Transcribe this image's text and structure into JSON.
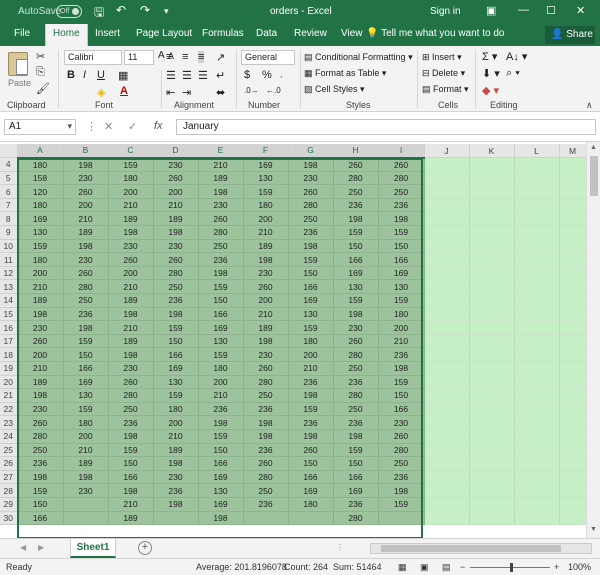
{
  "titlebar": {
    "autosave_label": "AutoSave",
    "autosave_state": "Off",
    "title": "orders - Excel",
    "signin": "Sign in"
  },
  "tabs": [
    "File",
    "Home",
    "Insert",
    "Page Layout",
    "Formulas",
    "Data",
    "Review",
    "View"
  ],
  "active_tab": "Home",
  "tell_me": "Tell me what you want to do",
  "share": "Share",
  "ribbon": {
    "groups": [
      "Clipboard",
      "Font",
      "Alignment",
      "Number",
      "Styles",
      "Cells",
      "Editing"
    ],
    "paste_label": "Paste",
    "font_name": "Calibri",
    "font_size": "11",
    "number_format": "General",
    "styles": [
      "Conditional Formatting",
      "Format as Table",
      "Cell Styles"
    ],
    "cells": [
      "Insert",
      "Delete",
      "Format"
    ]
  },
  "formula_bar": {
    "name_box": "A1",
    "value": "January"
  },
  "grid": {
    "columns": [
      "A",
      "B",
      "C",
      "D",
      "E",
      "F",
      "G",
      "H",
      "I",
      "J",
      "K",
      "L",
      "M"
    ],
    "selected_columns": [
      "A",
      "B",
      "C",
      "D",
      "E",
      "F",
      "G",
      "H",
      "I"
    ],
    "rows": [
      {
        "n": "4",
        "cells": [
          "180",
          "198",
          "159",
          "230",
          "210",
          "169",
          "198",
          "260",
          "260"
        ]
      },
      {
        "n": "5",
        "cells": [
          "158",
          "230",
          "180",
          "260",
          "189",
          "130",
          "230",
          "280",
          "280"
        ]
      },
      {
        "n": "6",
        "cells": [
          "120",
          "260",
          "200",
          "200",
          "198",
          "159",
          "260",
          "250",
          "250"
        ]
      },
      {
        "n": "7",
        "cells": [
          "180",
          "200",
          "210",
          "210",
          "230",
          "180",
          "280",
          "236",
          "236"
        ]
      },
      {
        "n": "8",
        "cells": [
          "169",
          "210",
          "189",
          "189",
          "260",
          "200",
          "250",
          "198",
          "198"
        ]
      },
      {
        "n": "9",
        "cells": [
          "130",
          "189",
          "198",
          "198",
          "280",
          "210",
          "236",
          "159",
          "159"
        ]
      },
      {
        "n": "10",
        "cells": [
          "159",
          "198",
          "230",
          "230",
          "250",
          "189",
          "198",
          "150",
          "150"
        ]
      },
      {
        "n": "11",
        "cells": [
          "180",
          "230",
          "260",
          "260",
          "236",
          "198",
          "159",
          "166",
          "166"
        ]
      },
      {
        "n": "12",
        "cells": [
          "200",
          "260",
          "200",
          "280",
          "198",
          "230",
          "150",
          "169",
          "169"
        ]
      },
      {
        "n": "13",
        "cells": [
          "210",
          "280",
          "210",
          "250",
          "159",
          "260",
          "166",
          "130",
          "130"
        ]
      },
      {
        "n": "14",
        "cells": [
          "189",
          "250",
          "189",
          "236",
          "150",
          "200",
          "169",
          "159",
          "159"
        ]
      },
      {
        "n": "15",
        "cells": [
          "198",
          "236",
          "198",
          "198",
          "166",
          "210",
          "130",
          "198",
          "180"
        ]
      },
      {
        "n": "16",
        "cells": [
          "230",
          "198",
          "210",
          "159",
          "169",
          "189",
          "159",
          "230",
          "200"
        ]
      },
      {
        "n": "17",
        "cells": [
          "260",
          "159",
          "189",
          "150",
          "130",
          "198",
          "180",
          "260",
          "210"
        ]
      },
      {
        "n": "18",
        "cells": [
          "200",
          "150",
          "198",
          "166",
          "159",
          "230",
          "200",
          "280",
          "236"
        ]
      },
      {
        "n": "19",
        "cells": [
          "210",
          "166",
          "230",
          "169",
          "180",
          "260",
          "210",
          "250",
          "198"
        ]
      },
      {
        "n": "20",
        "cells": [
          "189",
          "169",
          "260",
          "130",
          "200",
          "280",
          "236",
          "236",
          "159"
        ]
      },
      {
        "n": "21",
        "cells": [
          "198",
          "130",
          "280",
          "159",
          "210",
          "250",
          "198",
          "280",
          "150"
        ]
      },
      {
        "n": "22",
        "cells": [
          "230",
          "159",
          "250",
          "180",
          "236",
          "236",
          "159",
          "250",
          "166"
        ]
      },
      {
        "n": "23",
        "cells": [
          "260",
          "180",
          "236",
          "200",
          "198",
          "198",
          "236",
          "236",
          "230"
        ]
      },
      {
        "n": "24",
        "cells": [
          "280",
          "200",
          "198",
          "210",
          "159",
          "198",
          "198",
          "198",
          "260"
        ]
      },
      {
        "n": "25",
        "cells": [
          "250",
          "210",
          "159",
          "189",
          "150",
          "236",
          "260",
          "159",
          "280"
        ]
      },
      {
        "n": "26",
        "cells": [
          "236",
          "189",
          "150",
          "198",
          "166",
          "260",
          "150",
          "150",
          "250"
        ]
      },
      {
        "n": "27",
        "cells": [
          "198",
          "198",
          "166",
          "230",
          "169",
          "280",
          "166",
          "166",
          "236"
        ]
      },
      {
        "n": "28",
        "cells": [
          "159",
          "230",
          "198",
          "236",
          "130",
          "250",
          "169",
          "169",
          "198"
        ]
      },
      {
        "n": "29",
        "cells": [
          "150",
          "",
          "210",
          "198",
          "169",
          "236",
          "180",
          "236",
          "159"
        ]
      },
      {
        "n": "30",
        "cells": [
          "166",
          "",
          "189",
          "",
          "198",
          "",
          "",
          "280",
          ""
        ]
      }
    ]
  },
  "sheet_tab": "Sheet1",
  "status": {
    "mode": "Ready",
    "average": "Average: 201.8196078",
    "count": "Count: 264",
    "sum": "Sum: 51464",
    "zoom": "100%"
  }
}
